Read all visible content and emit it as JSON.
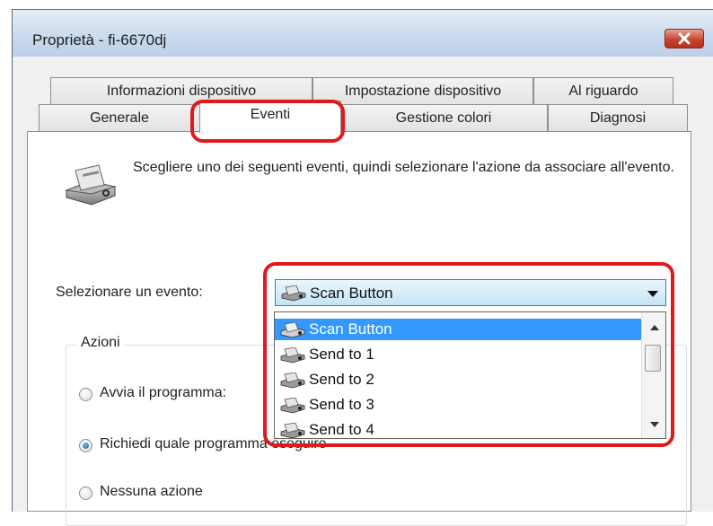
{
  "window": {
    "title": "Proprietà - fi-6670dj"
  },
  "tabs": {
    "row_back": [
      "Informazioni dispositivo",
      "Impostazione dispositivo",
      "Al riguardo"
    ],
    "row_front": [
      "Generale",
      "Eventi",
      "Gestione colori",
      "Diagnosi"
    ],
    "active": "Eventi"
  },
  "events": {
    "description": "Scegliere uno dei seguenti eventi, quindi selezionare l'azione da associare all'evento.",
    "select_label": "Selezionare un evento:",
    "selected": "Scan Button",
    "options": [
      "Scan Button",
      "Send to 1",
      "Send to 2",
      "Send to 3",
      "Send to 4"
    ],
    "icon": "scanner-icon"
  },
  "actions": {
    "group_title": "Azioni",
    "options": [
      {
        "label": "Avvia il programma:",
        "checked": false
      },
      {
        "label": "Richiedi quale programma eseguire",
        "checked": true
      },
      {
        "label": "Nessuna azione",
        "checked": false
      }
    ]
  },
  "colors": {
    "highlight": "#e01a1a",
    "selection": "#3399ff"
  }
}
